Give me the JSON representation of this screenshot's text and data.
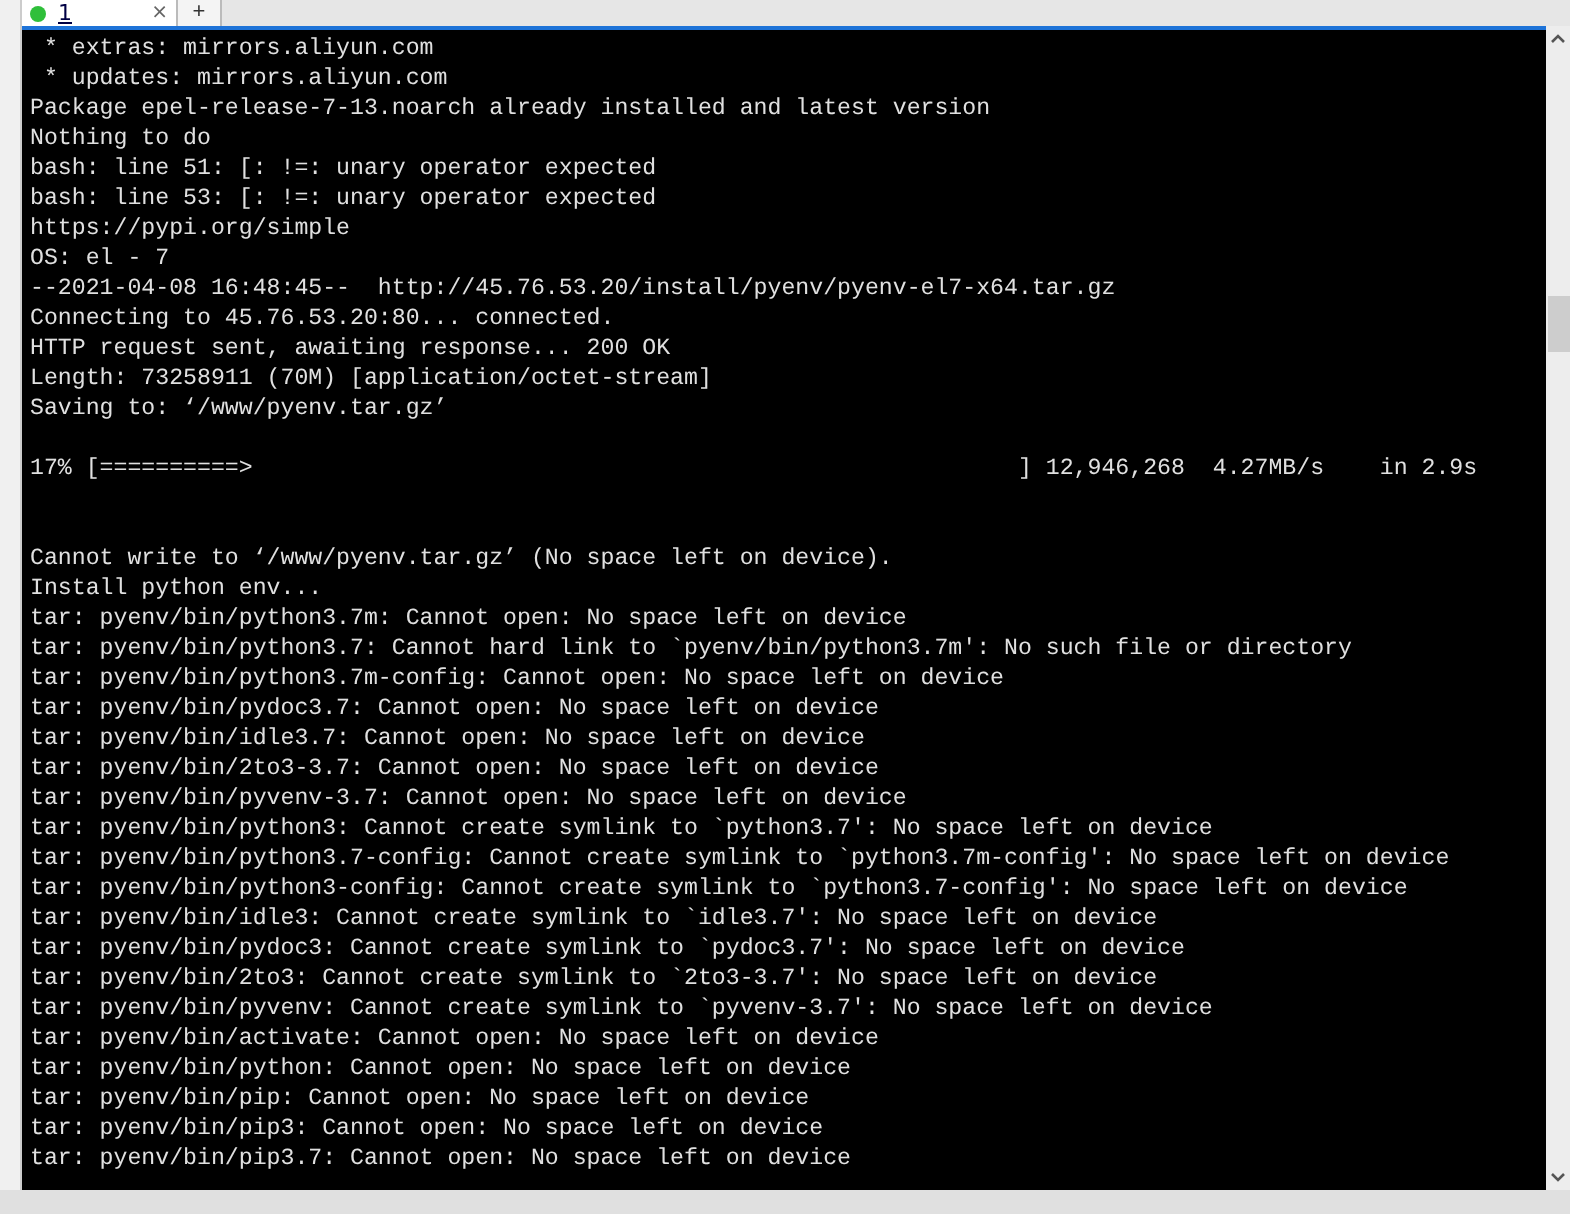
{
  "tabs": [
    {
      "label": "1",
      "selected": true,
      "close": "×"
    }
  ],
  "new_tab": "+",
  "terminal": {
    "lines": [
      {
        "kind": "text",
        "text": " * extras: mirrors.aliyun.com"
      },
      {
        "kind": "text",
        "text": " * updates: mirrors.aliyun.com"
      },
      {
        "kind": "text",
        "text": "Package epel-release-7-13.noarch already installed and latest version"
      },
      {
        "kind": "text",
        "text": "Nothing to do"
      },
      {
        "kind": "text",
        "text": "bash: line 51: [: !=: unary operator expected"
      },
      {
        "kind": "text",
        "text": "bash: line 53: [: !=: unary operator expected"
      },
      {
        "kind": "text",
        "text": "https://pypi.org/simple"
      },
      {
        "kind": "text",
        "text": "OS: el - 7"
      },
      {
        "kind": "text",
        "text": "--2021-04-08 16:48:45--  http://45.76.53.20/install/pyenv/pyenv-el7-x64.tar.gz"
      },
      {
        "kind": "text",
        "text": "Connecting to 45.76.53.20:80... connected."
      },
      {
        "kind": "text",
        "text": "HTTP request sent, awaiting response... 200 OK"
      },
      {
        "kind": "text",
        "text": "Length: 73258911 (70M) [application/octet-stream]"
      },
      {
        "kind": "text",
        "text": "Saving to: ‘/www/pyenv.tar.gz’"
      },
      {
        "kind": "blank"
      },
      {
        "kind": "progress",
        "bar": "17% [==========>",
        "stats": "] 12,946,268  4.27MB/s    in 2.9s"
      },
      {
        "kind": "blank"
      },
      {
        "kind": "blank"
      },
      {
        "kind": "text",
        "text": "Cannot write to ‘/www/pyenv.tar.gz’ (No space left on device)."
      },
      {
        "kind": "text",
        "text": "Install python env..."
      },
      {
        "kind": "text",
        "text": "tar: pyenv/bin/python3.7m: Cannot open: No space left on device"
      },
      {
        "kind": "text",
        "text": "tar: pyenv/bin/python3.7: Cannot hard link to `pyenv/bin/python3.7m': No such file or directory"
      },
      {
        "kind": "text",
        "text": "tar: pyenv/bin/python3.7m-config: Cannot open: No space left on device"
      },
      {
        "kind": "text",
        "text": "tar: pyenv/bin/pydoc3.7: Cannot open: No space left on device"
      },
      {
        "kind": "text",
        "text": "tar: pyenv/bin/idle3.7: Cannot open: No space left on device"
      },
      {
        "kind": "text",
        "text": "tar: pyenv/bin/2to3-3.7: Cannot open: No space left on device"
      },
      {
        "kind": "text",
        "text": "tar: pyenv/bin/pyvenv-3.7: Cannot open: No space left on device"
      },
      {
        "kind": "text",
        "text": "tar: pyenv/bin/python3: Cannot create symlink to `python3.7': No space left on device"
      },
      {
        "kind": "text",
        "text": "tar: pyenv/bin/python3.7-config: Cannot create symlink to `python3.7m-config': No space left on device"
      },
      {
        "kind": "text",
        "text": "tar: pyenv/bin/python3-config: Cannot create symlink to `python3.7-config': No space left on device"
      },
      {
        "kind": "text",
        "text": "tar: pyenv/bin/idle3: Cannot create symlink to `idle3.7': No space left on device"
      },
      {
        "kind": "text",
        "text": "tar: pyenv/bin/pydoc3: Cannot create symlink to `pydoc3.7': No space left on device"
      },
      {
        "kind": "text",
        "text": "tar: pyenv/bin/2to3: Cannot create symlink to `2to3-3.7': No space left on device"
      },
      {
        "kind": "text",
        "text": "tar: pyenv/bin/pyvenv: Cannot create symlink to `pyvenv-3.7': No space left on device"
      },
      {
        "kind": "text",
        "text": "tar: pyenv/bin/activate: Cannot open: No space left on device"
      },
      {
        "kind": "text",
        "text": "tar: pyenv/bin/python: Cannot open: No space left on device"
      },
      {
        "kind": "text",
        "text": "tar: pyenv/bin/pip: Cannot open: No space left on device"
      },
      {
        "kind": "text",
        "text": "tar: pyenv/bin/pip3: Cannot open: No space left on device"
      },
      {
        "kind": "text",
        "text": "tar: pyenv/bin/pip3.7: Cannot open: No space left on device"
      }
    ]
  }
}
